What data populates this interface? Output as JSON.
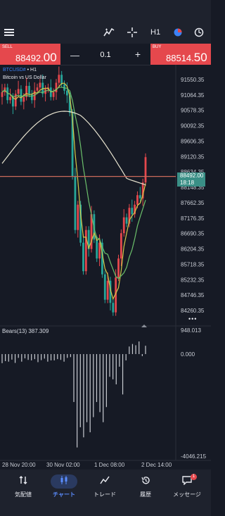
{
  "header": {
    "timeframe": "H1"
  },
  "trade": {
    "sell_label": "SELL",
    "sell_price_main": "88492.",
    "sell_price_big": "00",
    "buy_label": "BUY",
    "buy_price_main": "88514.",
    "buy_price_big": "50",
    "lot": "0.1",
    "minus": "—",
    "plus": "+"
  },
  "chart": {
    "symbol": "BTCUSD#",
    "timeframe": "H1",
    "description": "Bitcoin vs US Dollar",
    "current_price": "88492.00",
    "countdown": "18:18",
    "indicator_label": "Bears(13) 387.309",
    "more": "•••",
    "price_ticks": [
      "91550.35",
      "91064.35",
      "90578.35",
      "90092.35",
      "89606.35",
      "89120.35",
      "88634.35",
      "88148.35",
      "87662.35",
      "87176.35",
      "86690.35",
      "86204.35",
      "85718.35",
      "85232.35",
      "84746.35",
      "84260.35"
    ],
    "indicator_ticks": [
      "948.013",
      "0.000",
      "-4046.215"
    ],
    "time_labels": [
      "28 Nov 20:00",
      "30 Nov 02:00",
      "1 Dec 08:00",
      "2 Dec 14:00"
    ],
    "colors": {
      "up": "#e5484d",
      "down": "#26a69a",
      "ma_slow": "#e8e4d0",
      "ma_fast": "#d4c94a",
      "ma_mid": "#6bbf6b",
      "bid_line": "#c96a5a"
    }
  },
  "chart_data": {
    "type": "candlestick",
    "symbol": "BTCUSD#",
    "timeframe": "H1",
    "title": "Bitcoin vs US Dollar",
    "ylim": [
      84000,
      91900
    ],
    "close_series": [
      91150,
      91300,
      90900,
      91000,
      90700,
      91100,
      91250,
      90850,
      91000,
      91350,
      91100,
      90900,
      91200,
      91300,
      91450,
      91100,
      91250,
      91300,
      91000,
      91150,
      91450,
      91700,
      91400,
      91200,
      91050,
      90500,
      88500,
      86800,
      87600,
      86400,
      85500,
      86800,
      86200,
      87300,
      86500,
      85900,
      86400,
      85400,
      84600,
      85200,
      84500,
      84200,
      85300,
      85900,
      86700,
      87200,
      87000,
      87500,
      87300,
      87600,
      87900,
      87800,
      88300,
      89100
    ],
    "series": [
      {
        "name": "Bears(13)",
        "values": [
          -360,
          -280,
          -300,
          -220,
          -350,
          -150,
          -300,
          -170,
          -230,
          -250,
          -200,
          -320,
          -240,
          -180,
          -300,
          -250,
          -250,
          -200,
          -230,
          -300,
          -150,
          -120,
          -1900,
          -3700,
          -2900,
          -3300,
          -2700,
          -3100,
          -2500,
          -1900,
          -2300,
          -2700,
          -2100,
          -900,
          -1000,
          -1200,
          -500,
          -1600,
          -250,
          300,
          400,
          350,
          500,
          -80,
          330
        ]
      }
    ]
  }
}
